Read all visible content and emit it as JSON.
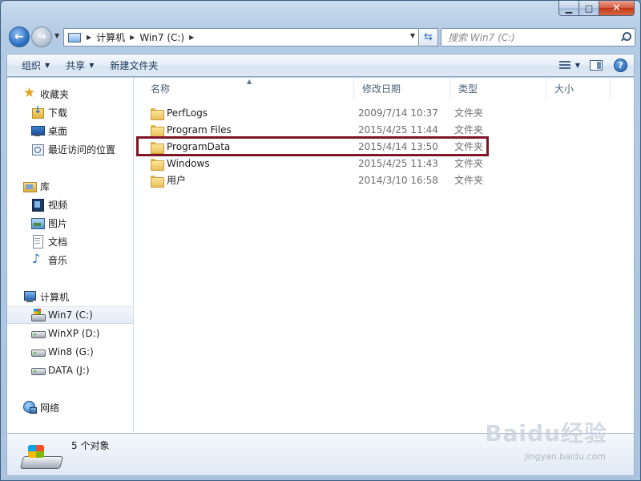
{
  "window": {
    "caption": {
      "minimize": "▁",
      "maximize": "□",
      "close": "✕"
    }
  },
  "address_bar": {
    "segments": [
      "计算机",
      "Win7 (C:)"
    ],
    "icon": "computer-icon"
  },
  "search": {
    "placeholder": "搜索 Win7 (C:)"
  },
  "toolbar": {
    "organize_label": "组织",
    "share_label": "共享",
    "new_folder_label": "新建文件夹",
    "help_label": "?"
  },
  "nav_pane": {
    "favorites": {
      "label": "收藏夹",
      "items": [
        "下载",
        "桌面",
        "最近访问的位置"
      ]
    },
    "libraries": {
      "label": "库",
      "items": [
        "视频",
        "图片",
        "文档",
        "音乐"
      ]
    },
    "computer": {
      "label": "计算机",
      "items": [
        "Win7 (C:)",
        "WinXP (D:)",
        "Win8 (G:)",
        "DATA (J:)"
      ],
      "selected": "Win7 (C:)"
    },
    "network": {
      "label": "网络"
    }
  },
  "columns": {
    "name": "名称",
    "date_modified": "修改日期",
    "type": "类型",
    "size": "大小"
  },
  "files": [
    {
      "name": "PerfLogs",
      "date": "2009/7/14 10:37",
      "type": "文件夹"
    },
    {
      "name": "Program Files",
      "date": "2015/4/25 11:44",
      "type": "文件夹"
    },
    {
      "name": "ProgramData",
      "date": "2015/4/14 13:50",
      "type": "文件夹"
    },
    {
      "name": "Windows",
      "date": "2015/4/25 11:43",
      "type": "文件夹"
    },
    {
      "name": "用户",
      "date": "2014/3/10 16:58",
      "type": "文件夹"
    }
  ],
  "highlighted_file": "ProgramData",
  "highlight_color": "#7f1628",
  "details": {
    "status": "5 个对象"
  },
  "watermark": {
    "text": "Baidu经验",
    "sub": "jingyan.baidu.com"
  }
}
